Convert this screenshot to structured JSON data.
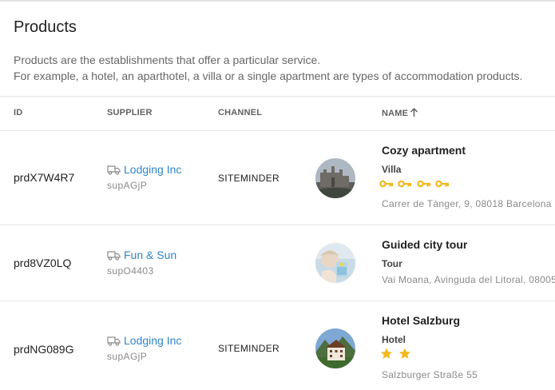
{
  "page": {
    "title": "Products",
    "description_line1": "Products are the establishments that offer a particular service.",
    "description_line2": "For example, a hotel, an aparthotel, a villa or a single apartment are types of accommodation products."
  },
  "table": {
    "columns": {
      "id": "ID",
      "supplier": "SUPPLIER",
      "channel": "CHANNEL",
      "name": "NAME"
    },
    "sort": {
      "column": "name",
      "direction": "ascending"
    },
    "rows": [
      {
        "id": "prdX7W4R7",
        "supplier_name": "Lodging Inc",
        "supplier_id": "supAGjP",
        "channel": "SITEMINDER",
        "image": "castle-photo",
        "name": "Cozy apartment",
        "type": "Villa",
        "rating_icon": "key-icon",
        "rating": 4,
        "address": "Carrer de Tànger, 9, 08018 Barcelona ("
      },
      {
        "id": "prd8VZ0LQ",
        "supplier_name": "Fun & Sun",
        "supplier_id": "supO4403",
        "channel": "",
        "image": "beach-drink-photo",
        "name": "Guided city tour",
        "type": "Tour",
        "rating_icon": "",
        "rating": 0,
        "address": "Vai Moana, Avinguda del Litoral, 08005"
      },
      {
        "id": "prdNG089G",
        "supplier_name": "Lodging Inc",
        "supplier_id": "supAGjP",
        "channel": "SITEMINDER",
        "image": "alpine-hotel-photo",
        "name": "Hotel Salzburg",
        "type": "Hotel",
        "rating_icon": "star-icon",
        "rating": 2,
        "address": "Salzburger Straße 55"
      }
    ]
  },
  "colors": {
    "link": "#2f86c7",
    "rating": "#f2b81f",
    "divider": "#e6e6e6"
  }
}
